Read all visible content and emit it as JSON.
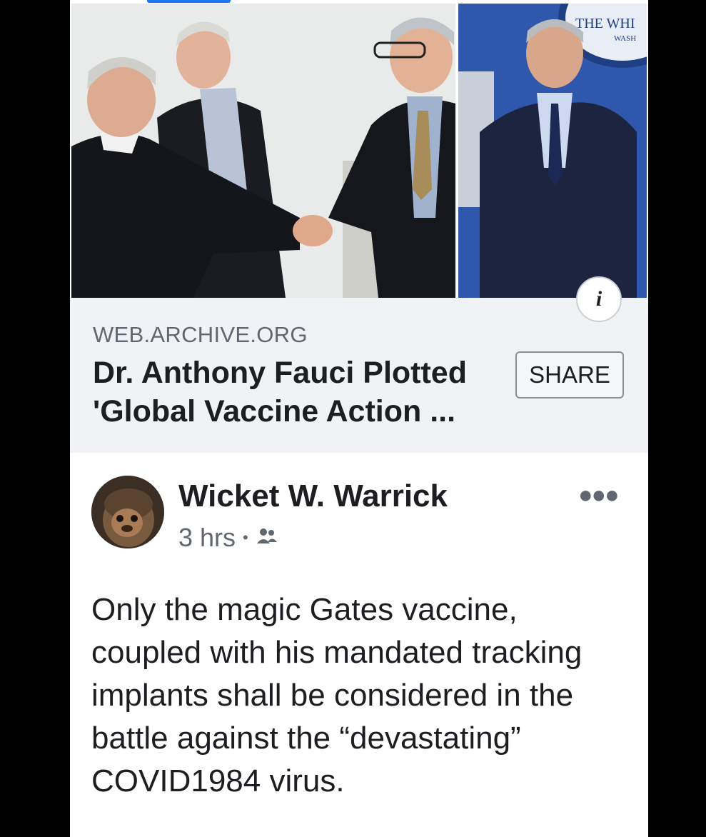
{
  "link_preview": {
    "domain": "WEB.ARCHIVE.ORG",
    "headline": "Dr. Anthony Fauci Plotted 'Global Vaccine Action ...",
    "share_label": "SHARE",
    "info_label": "i",
    "photo_right_sign_line1": "THE WHI",
    "photo_right_sign_line2": "WASH"
  },
  "post": {
    "author": "Wicket W. Warrick",
    "time": "3 hrs",
    "separator": "•",
    "privacy_icon": "friends-icon",
    "more_icon": "more-options-icon",
    "text": "Only the magic Gates vaccine, coupled with his mandated tracking implants shall be considered in the battle against the “devastating” COVID1984 virus."
  },
  "colors": {
    "accent": "#1877f2",
    "panel_bg": "#f0f2f5",
    "text_primary": "#1c1e21",
    "text_secondary": "#606770"
  }
}
